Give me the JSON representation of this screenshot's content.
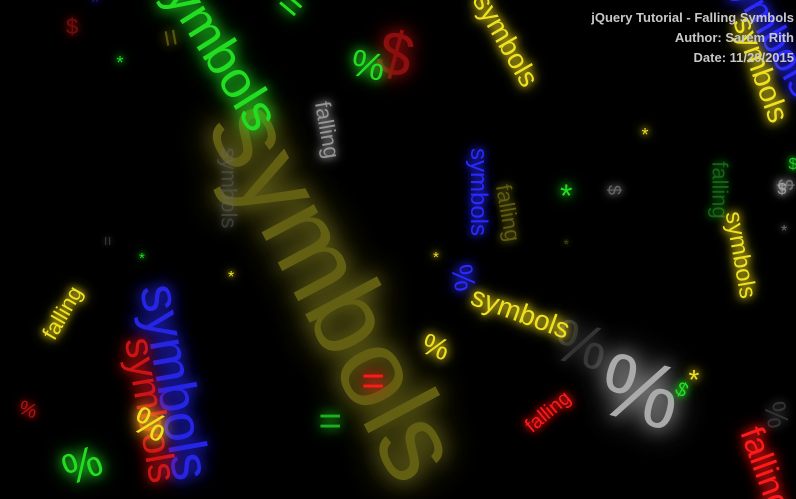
{
  "info": {
    "title": "jQuery Tutorial - Falling Symbols",
    "author": "Author: Sarem Rith",
    "date": "Date: 11/20/2015"
  },
  "colors": {
    "background": "#000000",
    "info_text": "#c8c8c8",
    "red": "#ff1a1a",
    "green": "#22dd22",
    "blue": "#2a2aff",
    "yellow": "#f0e020",
    "gray": "#bbbbbb"
  },
  "symbols": [
    {
      "text": "symbols",
      "color": "#6e6a14",
      "glow": "#8a8620",
      "opacity": 0.9
    },
    {
      "text": "symbols",
      "color": "#22dd22",
      "glow": "#22dd22",
      "opacity": 1
    },
    {
      "text": "%",
      "color": "#22dd22",
      "glow": "#22dd22",
      "opacity": 1
    },
    {
      "text": "$",
      "color": "#ff1a1a",
      "glow": "#ff1a1a",
      "opacity": 0.55
    },
    {
      "text": "symbols",
      "color": "#f0e020",
      "glow": "#f0e020",
      "opacity": 1
    },
    {
      "text": "symbols",
      "color": "#f0e020",
      "glow": "#f0e020",
      "opacity": 1
    },
    {
      "text": "falling",
      "color": "#bbbbbb",
      "glow": "#bbbbbb",
      "opacity": 0.8
    },
    {
      "text": "symbols",
      "color": "#666666",
      "glow": "#666666",
      "opacity": 0.55
    },
    {
      "text": "symbols",
      "color": "#2a2aff",
      "glow": "#2a2aff",
      "opacity": 1
    },
    {
      "text": "falling",
      "color": "#6e6a14",
      "glow": "#6e6a14",
      "opacity": 0.85
    },
    {
      "text": "%",
      "color": "#2a2aff",
      "glow": "#2a2aff",
      "opacity": 1
    },
    {
      "text": "*",
      "color": "#22dd22",
      "glow": "#22dd22",
      "opacity": 1
    },
    {
      "text": "$",
      "color": "#888888",
      "glow": "#888888",
      "opacity": 0.75
    },
    {
      "text": "falling",
      "color": "#1b7d1b",
      "glow": "#1b7d1b",
      "opacity": 0.8
    },
    {
      "text": "symbols",
      "color": "#f0e020",
      "glow": "#f0e020",
      "opacity": 1
    },
    {
      "text": "*",
      "color": "#f0e020",
      "glow": "#f0e020",
      "opacity": 1
    },
    {
      "text": "*",
      "color": "#5a5a14",
      "glow": "#5a5a14",
      "opacity": 0.8
    },
    {
      "text": "*",
      "color": "#22dd22",
      "glow": "#22dd22",
      "opacity": 1
    },
    {
      "text": "=",
      "color": "#444444",
      "glow": "#444444",
      "opacity": 0.8
    },
    {
      "text": "*",
      "color": "#22dd22",
      "glow": "#22dd22",
      "opacity": 1
    },
    {
      "text": "*",
      "color": "#f0e020",
      "glow": "#f0e020",
      "opacity": 1
    },
    {
      "text": "*",
      "color": "#f0e020",
      "glow": "#f0e020",
      "opacity": 1
    },
    {
      "text": "falling",
      "color": "#f0e020",
      "glow": "#f0e020",
      "opacity": 1
    },
    {
      "text": "symbols",
      "color": "#2a2aff",
      "glow": "#2a2aff",
      "opacity": 0.9
    },
    {
      "text": "symbols",
      "color": "#ff1a1a",
      "glow": "#ff1a1a",
      "opacity": 0.8
    },
    {
      "text": "%",
      "color": "#f0e020",
      "glow": "#f0e020",
      "opacity": 1
    },
    {
      "text": "%",
      "color": "#ff1a1a",
      "glow": "#ff1a1a",
      "opacity": 0.7
    },
    {
      "text": "%",
      "color": "#22dd22",
      "glow": "#22dd22",
      "opacity": 1
    },
    {
      "text": "=",
      "color": "#22dd22",
      "glow": "#22dd22",
      "opacity": 0.8
    },
    {
      "text": "=",
      "color": "#ff1a1a",
      "glow": "#ff1a1a",
      "opacity": 1
    },
    {
      "text": "%",
      "color": "#f0e020",
      "glow": "#f0e020",
      "opacity": 1
    },
    {
      "text": "%",
      "color": "#c8c8c8",
      "glow": "#c8c8c8",
      "opacity": 0.85
    },
    {
      "text": "%",
      "color": "#666666",
      "glow": "#666666",
      "opacity": 0.5
    },
    {
      "text": "falling",
      "color": "#ff1a1a",
      "glow": "#ff1a1a",
      "opacity": 1
    },
    {
      "text": "$",
      "color": "#22dd22",
      "glow": "#22dd22",
      "opacity": 1
    },
    {
      "text": "*",
      "color": "#f0e020",
      "glow": "#f0e020",
      "opacity": 1
    },
    {
      "text": "symbols",
      "color": "#f0e020",
      "glow": "#f0e020",
      "opacity": 1
    },
    {
      "text": "$",
      "color": "#888888",
      "glow": "#888888",
      "opacity": 0.8
    },
    {
      "text": "*",
      "color": "#888888",
      "glow": "#888888",
      "opacity": 0.8
    },
    {
      "text": "symbols",
      "color": "#2a2aff",
      "glow": "#2a2aff",
      "opacity": 1
    },
    {
      "text": "%",
      "color": "#555555",
      "glow": "#555555",
      "opacity": 0.6
    },
    {
      "text": "falling",
      "color": "#ff1a1a",
      "glow": "#ff1a1a",
      "opacity": 1
    },
    {
      "text": "$",
      "color": "#ff1a1a",
      "glow": "#ff1a1a",
      "opacity": 0.45
    },
    {
      "text": "*",
      "color": "#2a2aff",
      "glow": "#2a2aff",
      "opacity": 0.5
    },
    {
      "text": "$",
      "color": "#22dd22",
      "glow": "#22dd22",
      "opacity": 0.9
    },
    {
      "text": "$",
      "color": "#bbbbbb",
      "glow": "#bbbbbb",
      "opacity": 0.8
    },
    {
      "text": "=",
      "color": "#6e6a14",
      "glow": "#6e6a14",
      "opacity": 0.8
    },
    {
      "text": "=",
      "color": "#22dd22",
      "glow": "#22dd22",
      "opacity": 1
    }
  ]
}
